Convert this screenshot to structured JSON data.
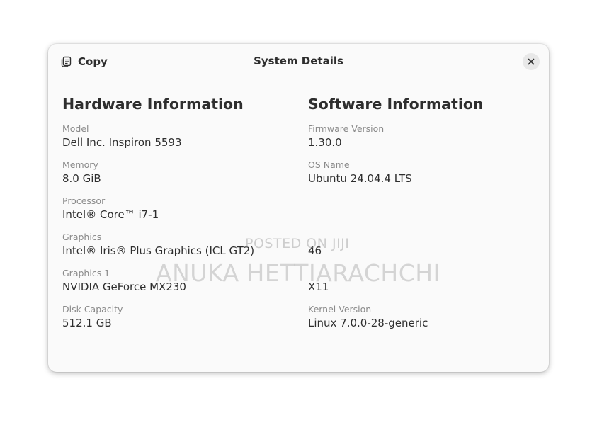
{
  "header": {
    "copy_label": "Copy",
    "title": "System Details"
  },
  "hardware": {
    "heading": "Hardware Information",
    "fields": [
      {
        "label": "Model",
        "value": "Dell Inc. Inspiron 5593"
      },
      {
        "label": "Memory",
        "value": "8.0 GiB"
      },
      {
        "label": "Processor",
        "value": "Intel® Core™ i7-1"
      },
      {
        "label": "Graphics",
        "value": "Intel® Iris® Plus Graphics (ICL GT2)"
      },
      {
        "label": "Graphics 1",
        "value": "NVIDIA GeForce MX230"
      },
      {
        "label": "Disk Capacity",
        "value": "512.1 GB"
      }
    ]
  },
  "software": {
    "heading": "Software Information",
    "fields": [
      {
        "label": "Firmware Version",
        "value": "1.30.0"
      },
      {
        "label": "OS Name",
        "value": "Ubuntu 24.04.4 LTS"
      },
      {
        "label": "",
        "value": ""
      },
      {
        "label": "",
        "value": "46"
      },
      {
        "label": "",
        "value": "X11"
      },
      {
        "label": "Kernel Version",
        "value": "Linux 7.0.0-28-generic"
      }
    ]
  },
  "watermark": {
    "line1": "POSTED ON JIJI",
    "line2": "ANUKA HETTIARACHCHI"
  },
  "icons": {
    "copy": "copy-icon",
    "close": "close-icon"
  }
}
